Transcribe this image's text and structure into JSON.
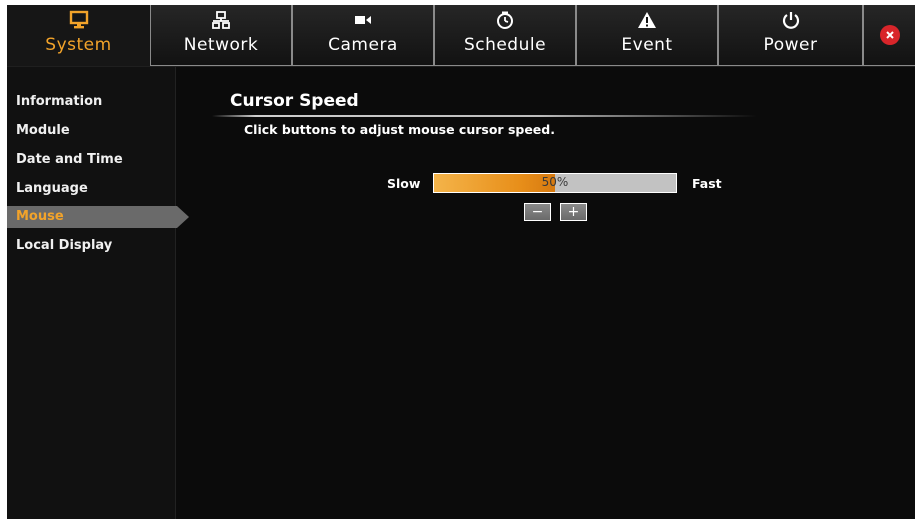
{
  "tabs": [
    {
      "label": "System",
      "icon": "monitor-icon",
      "active": true
    },
    {
      "label": "Network",
      "icon": "network-icon",
      "active": false
    },
    {
      "label": "Camera",
      "icon": "camera-icon",
      "active": false
    },
    {
      "label": "Schedule",
      "icon": "schedule-icon",
      "active": false
    },
    {
      "label": "Event",
      "icon": "warning-icon",
      "active": false
    },
    {
      "label": "Power",
      "icon": "power-icon",
      "active": false
    }
  ],
  "close_icon": "close-icon",
  "sidebar": {
    "items": [
      {
        "label": "Information"
      },
      {
        "label": "Module"
      },
      {
        "label": "Date and Time"
      },
      {
        "label": "Language"
      },
      {
        "label": "Mouse",
        "active": true
      },
      {
        "label": "Local Display"
      }
    ]
  },
  "main": {
    "title": "Cursor Speed",
    "description": "Click buttons to adjust mouse cursor speed.",
    "slow_label": "Slow",
    "fast_label": "Fast",
    "speed_percent": 50,
    "speed_text": "50%",
    "minus_label": "−",
    "plus_label": "+"
  },
  "colors": {
    "accent": "#f2a32a",
    "background": "#0b0b0b",
    "close": "#d8252a"
  }
}
